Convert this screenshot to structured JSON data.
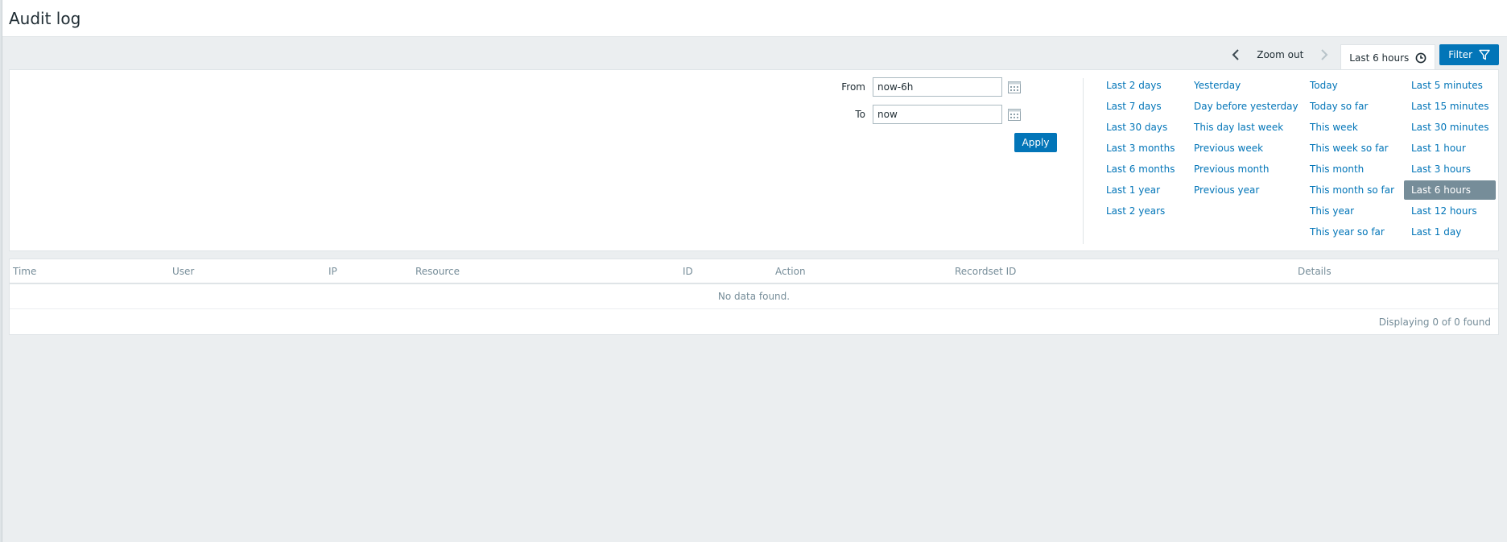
{
  "page": {
    "title": "Audit log"
  },
  "time_controls": {
    "zoom_out_label": "Zoom out",
    "active_tab_label": "Last 6 hours",
    "filter_label": "Filter"
  },
  "filter": {
    "from_label": "From",
    "from_value": "now-6h",
    "to_label": "To",
    "to_value": "now",
    "apply_label": "Apply"
  },
  "quick_ranges": {
    "col1": [
      "Last 2 days",
      "Last 7 days",
      "Last 30 days",
      "Last 3 months",
      "Last 6 months",
      "Last 1 year",
      "Last 2 years"
    ],
    "col2": [
      "Yesterday",
      "Day before yesterday",
      "This day last week",
      "Previous week",
      "Previous month",
      "Previous year"
    ],
    "col3": [
      "Today",
      "Today so far",
      "This week",
      "This week so far",
      "This month",
      "This month so far",
      "This year",
      "This year so far"
    ],
    "col4": [
      "Last 5 minutes",
      "Last 15 minutes",
      "Last 30 minutes",
      "Last 1 hour",
      "Last 3 hours",
      "Last 6 hours",
      "Last 12 hours",
      "Last 1 day"
    ],
    "selected": "Last 6 hours"
  },
  "table": {
    "columns": [
      "Time",
      "User",
      "IP",
      "Resource",
      "ID",
      "Action",
      "Recordset ID",
      "Details"
    ],
    "empty_message": "No data found.",
    "footer": "Displaying 0 of 0 found"
  },
  "colors": {
    "accent": "#0275b8",
    "selected_bg": "#768d99",
    "page_bg": "#ebeef0"
  }
}
